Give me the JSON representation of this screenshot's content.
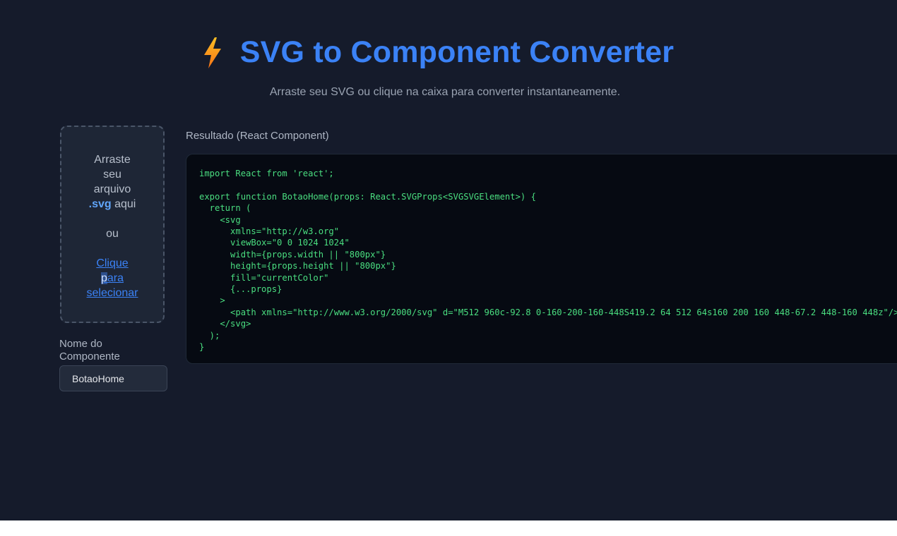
{
  "header": {
    "title": "SVG to Component Converter",
    "subtitle": "Arraste seu SVG ou clique na caixa para converter instantaneamente.",
    "logo_icon": "lightning-bolt-icon"
  },
  "dropzone": {
    "line1": "Arraste",
    "line2": "seu",
    "line3": "arquivo",
    "ext": ".svg",
    "line4_rest": " aqui",
    "or": "ou",
    "link_line1": "Clique",
    "link_line2_sel": "p",
    "link_line2_rest": "ara",
    "link_line3": "selecionar"
  },
  "component_name": {
    "label": "Nome do Componente",
    "value": "BotaoHome"
  },
  "result": {
    "label": "Resultado (React Component)",
    "code": "import React from 'react';\n\nexport function BotaoHome(props: React.SVGProps<SVGSVGElement>) {\n  return (\n    <svg\n      xmlns=\"http://w3.org\"\n      viewBox=\"0 0 1024 1024\"\n      width={props.width || \"800px\"}\n      height={props.height || \"800px\"}\n      fill=\"currentColor\"\n      {...props}\n    >\n      <path xmlns=\"http://www.w3.org/2000/svg\" d=\"M512 960c-92.8 0-160-200-160-448S419.2 64 512 64s160 200 160 448-67.2 448-160 448z\"/>\n    </svg>\n  );\n}"
  },
  "colors": {
    "background": "#151b2b",
    "accent": "#3b82f6",
    "code_text": "#4ade80"
  }
}
